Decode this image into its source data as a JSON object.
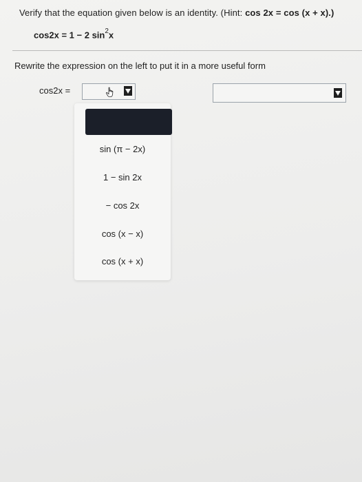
{
  "question": {
    "prompt_prefix": "Verify that the equation given below is an identity. (Hint: ",
    "hint_expr": "cos 2x = cos (x + x).)",
    "identity": {
      "lhs_rhs": "cos2x = 1 − 2 sin",
      "exponent": "2",
      "tail": "x"
    }
  },
  "instruction": "Rewrite the expression on the left to put it in a more useful form",
  "equation_row": {
    "lhs_label": "cos2x ="
  },
  "dropdown": {
    "options": [
      "sin (π − 2x)",
      "1 − sin 2x",
      "− cos 2x",
      "cos (x − x)",
      "cos (x + x)"
    ]
  },
  "icons": {
    "cursor": "hand-pointer-icon",
    "arrow": "dropdown-arrow-icon"
  },
  "colors": {
    "selected_option_bg": "#1b1f29",
    "select_border": "#9aa2aa"
  }
}
